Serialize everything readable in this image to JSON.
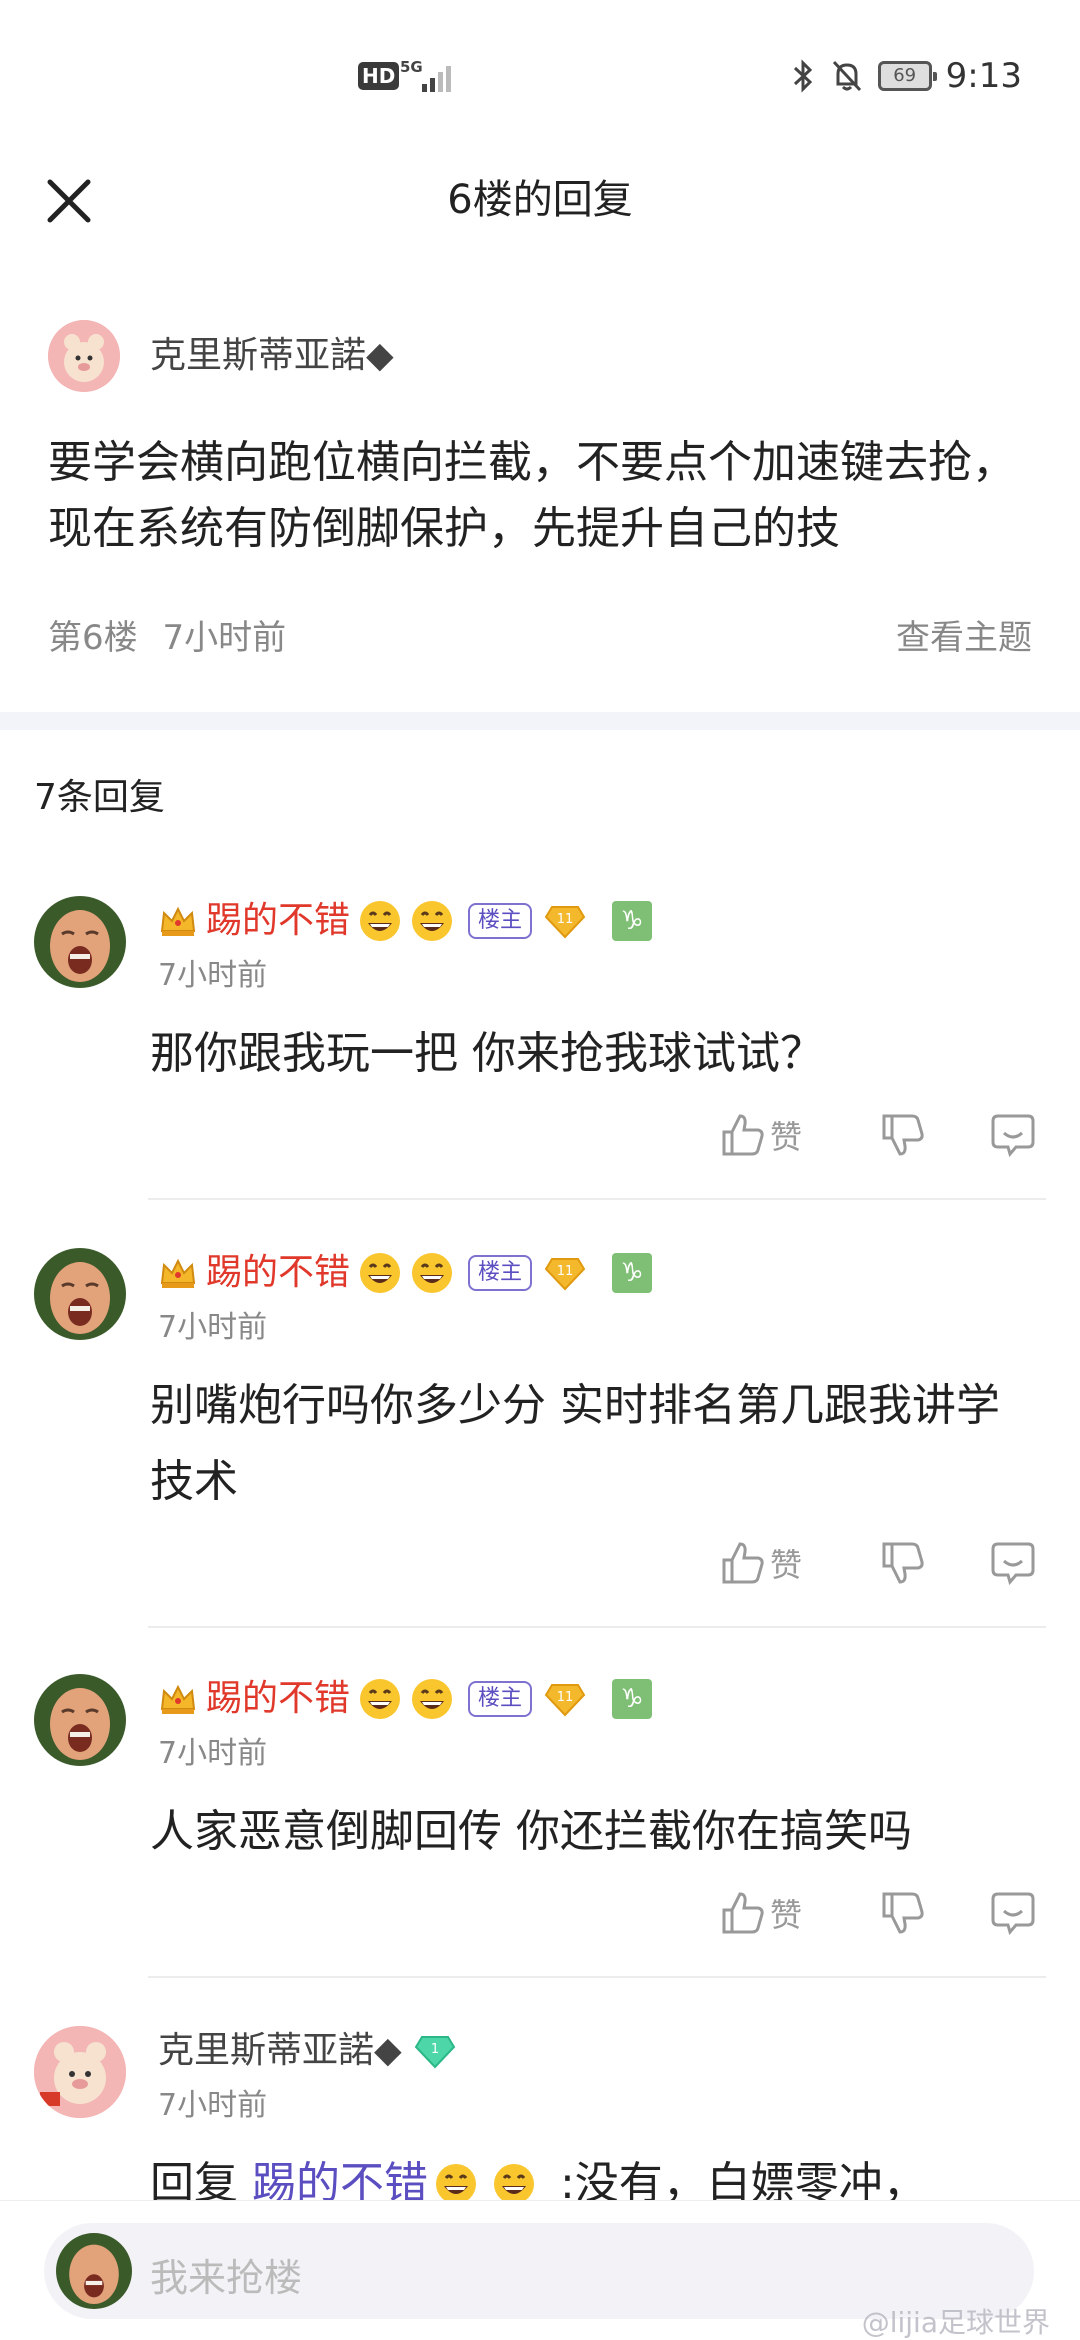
{
  "status_bar": {
    "hd": "HD",
    "network": "5G",
    "battery": "69",
    "time": "9:13"
  },
  "header": {
    "title": "6楼的回复"
  },
  "original_post": {
    "author": "克里斯蒂亚諾◆",
    "text": "要学会横向跑位横向拦截，不要点个加速键去抢，现在系统有防倒脚保护，先提升自己的技",
    "floor": "第6楼",
    "time": "7小时前",
    "view_topic": "查看主题"
  },
  "reply_count": "7条回复",
  "replies": [
    {
      "name": "踢的不错",
      "owner_tag": "楼主",
      "level": "11",
      "time": "7小时前",
      "text": "那你跟我玩一把 你来抢我球试试？",
      "like_label": "赞"
    },
    {
      "name": "踢的不错",
      "owner_tag": "楼主",
      "level": "11",
      "time": "7小时前",
      "text": "别嘴炮行吗你多少分 实时排名第几跟我讲学技术",
      "like_label": "赞"
    },
    {
      "name": "踢的不错",
      "owner_tag": "楼主",
      "level": "11",
      "time": "7小时前",
      "text": "人家恶意倒脚回传 你还拦截你在搞笑吗",
      "like_label": "赞"
    },
    {
      "name": "克里斯蒂亚諾◆",
      "time": "7小时前",
      "reply_prefix": "回复 ",
      "reply_to": "踢的不错",
      "text": " :没有，白嫖零冲，",
      "level": "1"
    }
  ],
  "bottom": {
    "placeholder": "我来抢楼",
    "watermark": "@lijia足球世界"
  },
  "colors": {
    "owner_name": "#e0382b",
    "owner_tag": "#5b4ec0",
    "separator": "#f2f4fa"
  }
}
